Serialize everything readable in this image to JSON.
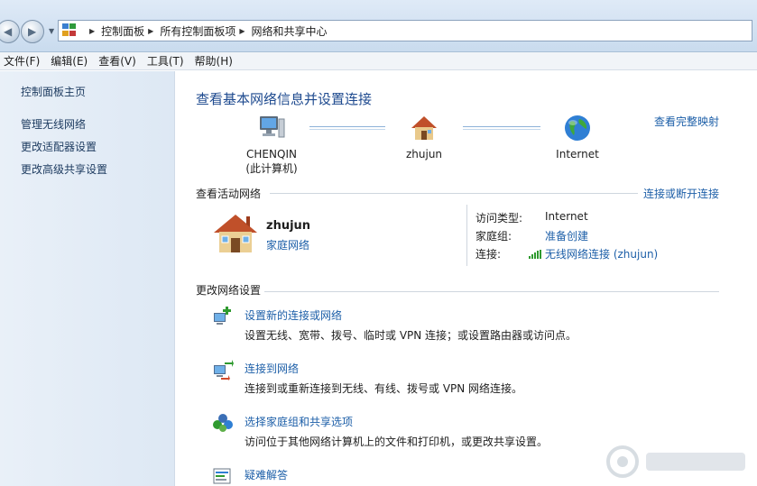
{
  "address_bar": {
    "crumbs": [
      "控制面板",
      "所有控制面板项",
      "网络和共享中心"
    ]
  },
  "menu": [
    "文件(F)",
    "编辑(E)",
    "查看(V)",
    "工具(T)",
    "帮助(H)"
  ],
  "left_pane": {
    "home": "控制面板主页",
    "links": [
      "管理无线网络",
      "更改适配器设置",
      "更改高级共享设置"
    ]
  },
  "main": {
    "title": "查看基本网络信息并设置连接",
    "full_map_link": "查看完整映射",
    "map": {
      "computer_name": "CHENQIN",
      "computer_sub": "(此计算机)",
      "network": "zhujun",
      "internet": "Internet"
    },
    "active": {
      "heading": "查看活动网络",
      "action": "连接或断开连接",
      "network_name": "zhujun",
      "network_type": "家庭网络",
      "access_type_label": "访问类型:",
      "access_type_value": "Internet",
      "homegroup_label": "家庭组:",
      "homegroup_value": "准备创建",
      "connection_label": "连接:",
      "connection_value": "无线网络连接 (zhujun)"
    },
    "change": {
      "heading": "更改网络设置",
      "tasks": [
        {
          "link": "设置新的连接或网络",
          "desc": "设置无线、宽带、拨号、临时或 VPN 连接；或设置路由器或访问点。"
        },
        {
          "link": "连接到网络",
          "desc": "连接到或重新连接到无线、有线、拨号或 VPN 网络连接。"
        },
        {
          "link": "选择家庭组和共享选项",
          "desc": "访问位于其他网络计算机上的文件和打印机，或更改共享设置。"
        },
        {
          "link": "疑难解答",
          "desc": ""
        }
      ]
    }
  },
  "colors": {
    "link": "#1d5fa8",
    "title": "#1e4a8f",
    "left_pane_bg": "#e3ecf6"
  }
}
